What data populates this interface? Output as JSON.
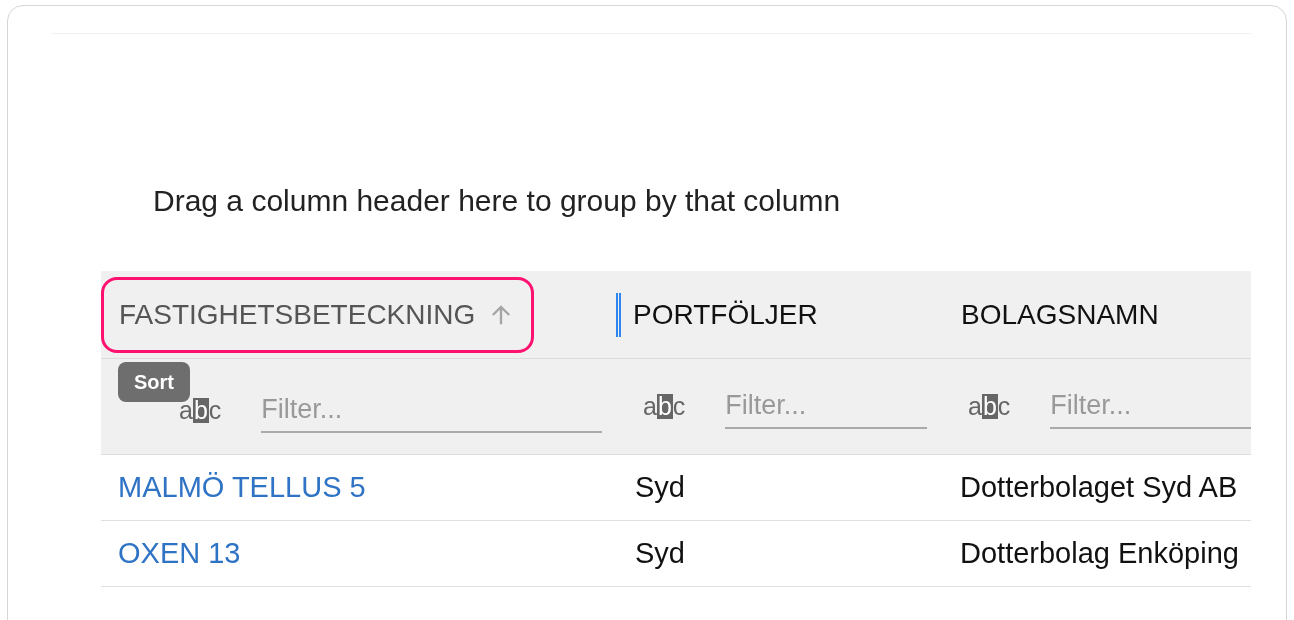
{
  "group_panel": {
    "text": "Drag a column header here to group by that column"
  },
  "columns": [
    {
      "label": "FASTIGHETSBETECKNING",
      "sorted_ascending": true,
      "highlighted": true,
      "resize_handle": false,
      "filter": {
        "icon_letters": [
          "a",
          "b",
          "c"
        ],
        "placeholder": "Filter..."
      }
    },
    {
      "label": "PORTFÖLJER",
      "sorted_ascending": false,
      "highlighted": false,
      "resize_handle": true,
      "filter": {
        "icon_letters": [
          "a",
          "b",
          "c"
        ],
        "placeholder": "Filter..."
      }
    },
    {
      "label": "BOLAGSNAMN",
      "sorted_ascending": false,
      "highlighted": false,
      "resize_handle": false,
      "filter": {
        "icon_letters": [
          "a",
          "b",
          "c"
        ],
        "placeholder": "Filter..."
      }
    }
  ],
  "tooltip": {
    "text": "Sort"
  },
  "rows": [
    {
      "cells": [
        "MALMÖ TELLUS 5",
        "Syd",
        "Dotterbolaget Syd AB"
      ]
    },
    {
      "cells": [
        "OXEN 13",
        "Syd",
        "Dotterbolag Enköping"
      ]
    }
  ]
}
